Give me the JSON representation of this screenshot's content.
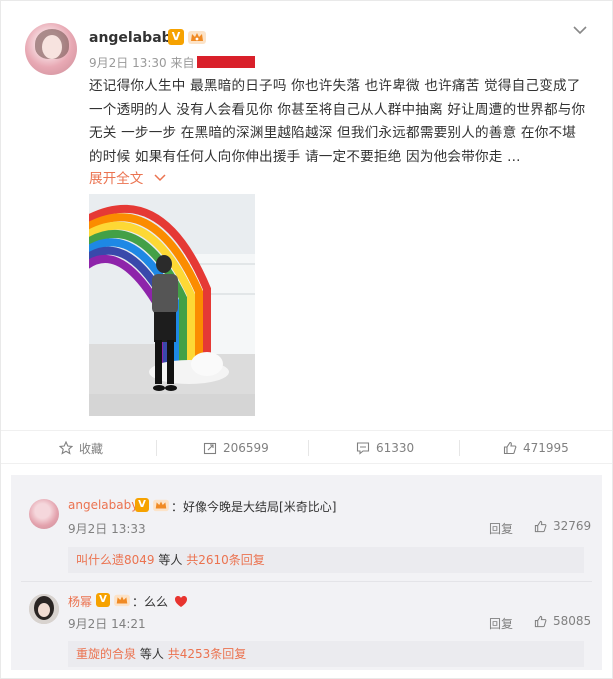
{
  "post": {
    "username": "angelababy",
    "verified_badge": "V",
    "date": "9月2日",
    "time": "13:30",
    "from_label": "来自",
    "text": "还记得你人生中 最黑暗的日子吗 你也许失落 也许卑微 也许痛苦 觉得自己变成了一个透明的人 没有人会看见你 你甚至将自己从人群中抽离 好让周遭的世界都与你无关 一步一步 在黑暗的深渊里越陷越深 但我们永远都需要别人的善意 在你不堪的时候 如果有任何人向你伸出援手 请一定不要拒绝 因为他会带你走 ...",
    "expand_label": "展开全文"
  },
  "actions": {
    "favorite_label": "收藏",
    "repost_count": "206599",
    "comment_count": "61330",
    "like_count": "471995"
  },
  "comments": [
    {
      "name": "angelababy",
      "verified_badge": "V",
      "colon": "：",
      "text": "好像今晚是大结局[米奇比心]",
      "date": "9月2日",
      "time": "13:33",
      "reply_label": "回复",
      "likes": "32769",
      "sub_user": "叫什么遗8049",
      "sub_mid": "等人",
      "sub_total": "共2610条回复"
    },
    {
      "name": "杨幂",
      "verified_badge": "V",
      "colon": "：",
      "text": "么么",
      "date": "9月2日",
      "time": "14:21",
      "reply_label": "回复",
      "likes": "58085",
      "sub_user": "重旋的合泉",
      "sub_mid": "等人",
      "sub_total": "共4253条回复"
    }
  ],
  "colors": {
    "accent": "#eb7350",
    "badge": "#f6a200",
    "redacted": "#d9202a",
    "heart": "#e8342f"
  }
}
